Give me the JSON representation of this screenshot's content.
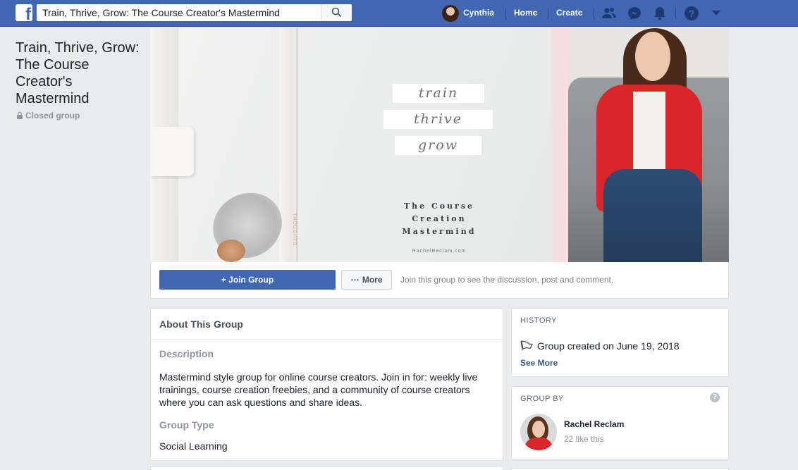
{
  "topbar": {
    "search_value": "Train, Thrive, Grow: The Course Creator's Mastermind",
    "user_name": "Cynthia",
    "nav_home": "Home",
    "nav_create": "Create",
    "icons": [
      "friends-icon",
      "messenger-icon",
      "notifications-icon",
      "help-icon",
      "account-menu-icon"
    ]
  },
  "group": {
    "title": "Train, Thrive, Grow: The Course Creator's Mastermind",
    "privacy": "Closed group"
  },
  "cover": {
    "words": [
      "train",
      "thrive",
      "grow"
    ],
    "subtitle_lines": [
      "The Course",
      "Creation",
      "Mastermind"
    ],
    "url": "RachelReclam.com",
    "notebook_text": "THOUGHTS"
  },
  "actions": {
    "join_label": "+ Join Group",
    "more_label": "More",
    "hint": "Join this group to see the discussion, post and comment."
  },
  "about": {
    "heading": "About This Group",
    "description_label": "Description",
    "description": "Mastermind style group for online course creators. Join in for: weekly live trainings, course creation freebies, and a community of course creators where you can ask questions and share ideas.",
    "type_label": "Group Type",
    "type_value": "Social Learning"
  },
  "history": {
    "label": "HISTORY",
    "created": "Group created on June 19, 2018",
    "see_more": "See More"
  },
  "group_by": {
    "label": "GROUP BY",
    "owner_name": "Rachel Reclam",
    "owner_likes": "22 like this"
  },
  "colors": {
    "brand": "#4267b2",
    "page_bg": "#e9ebee",
    "link": "#365899",
    "accent_red": "#d9262b"
  }
}
